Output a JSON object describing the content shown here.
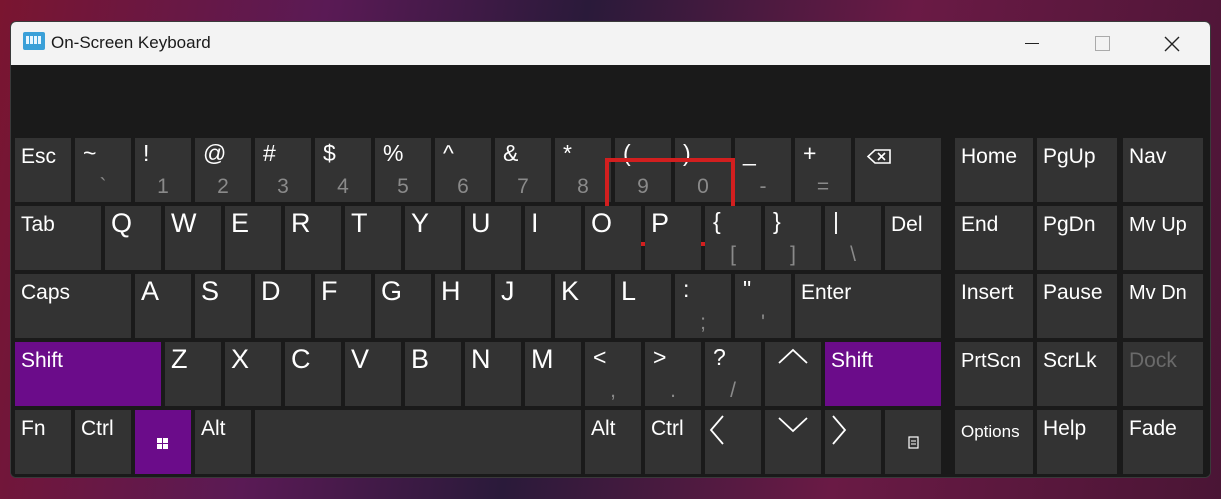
{
  "window": {
    "title": "On-Screen Keyboard",
    "app_icon": "keyboard-icon",
    "controls": {
      "minimize": "minimize-icon",
      "maximize": "maximize-icon",
      "close": "close-icon"
    }
  },
  "keys": {
    "esc": "Esc",
    "backtick": {
      "top": "~",
      "bottom": "`"
    },
    "n1": {
      "top": "!",
      "bottom": "1"
    },
    "n2": {
      "top": "@",
      "bottom": "2"
    },
    "n3": {
      "top": "#",
      "bottom": "3"
    },
    "n4": {
      "top": "$",
      "bottom": "4"
    },
    "n5": {
      "top": "%",
      "bottom": "5"
    },
    "n6": {
      "top": "^",
      "bottom": "6"
    },
    "n7": {
      "top": "&",
      "bottom": "7"
    },
    "n8": {
      "top": "*",
      "bottom": "8"
    },
    "n9": {
      "top": "(",
      "bottom": "9"
    },
    "n0": {
      "top": ")",
      "bottom": "0"
    },
    "minus": {
      "top": "_",
      "bottom": "-"
    },
    "equals": {
      "top": "+",
      "bottom": "="
    },
    "tab": "Tab",
    "q": "Q",
    "w": "W",
    "e": "E",
    "r": "R",
    "t": "T",
    "y": "Y",
    "u": "U",
    "i": "I",
    "o": "O",
    "p": "P",
    "lbracket": {
      "top": "{",
      "bottom": "["
    },
    "rbracket": {
      "top": "}",
      "bottom": "]"
    },
    "backslash": {
      "top": "|",
      "bottom": "\\"
    },
    "del": "Del",
    "caps": "Caps",
    "a": "A",
    "s": "S",
    "d": "D",
    "f": "F",
    "g": "G",
    "h": "H",
    "j": "J",
    "k": "K",
    "l": "L",
    "semicolon": {
      "top": ":",
      "bottom": ";"
    },
    "quote": {
      "top": "\"",
      "bottom": "'"
    },
    "enter": "Enter",
    "lshift": "Shift",
    "z": "Z",
    "x": "X",
    "c": "C",
    "v": "V",
    "b": "B",
    "n": "N",
    "m": "M",
    "comma": {
      "top": "<",
      "bottom": ","
    },
    "period": {
      "top": ">",
      "bottom": "."
    },
    "slash": {
      "top": "?",
      "bottom": "/"
    },
    "rshift": "Shift",
    "fn": "Fn",
    "lctrl": "Ctrl",
    "lalt": "Alt",
    "ralt": "Alt",
    "rctrl": "Ctrl",
    "home": "Home",
    "pgup": "PgUp",
    "nav": "Nav",
    "end": "End",
    "pgdn": "PgDn",
    "mvup": "Mv Up",
    "insert": "Insert",
    "pause": "Pause",
    "mvdn": "Mv Dn",
    "prtscn": "PrtScn",
    "scrlk": "ScrLk",
    "dock": "Dock",
    "options": "Options",
    "help": "Help",
    "fade": "Fade"
  },
  "colors": {
    "accent_purple": "#6b0c8a",
    "highlight_red": "#d21f1f",
    "key_bg": "#333333"
  }
}
